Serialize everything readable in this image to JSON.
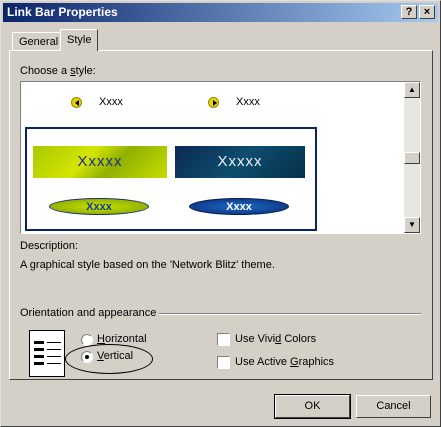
{
  "window": {
    "title": "Link Bar Properties",
    "help_label": "?",
    "close_label": "×"
  },
  "tabs": [
    {
      "label": "General"
    },
    {
      "label": "Style",
      "selected": true
    }
  ],
  "style_list": {
    "label_pre": "Choose a ",
    "label_key": "s",
    "label_post": "tyle:",
    "items": [
      {
        "text": "Xxxx",
        "bullet": "left-arrow-bullet"
      },
      {
        "text": "Xxxx",
        "bullet": "right-arrow-bullet"
      },
      {
        "text": "Xxxxx",
        "theme": "green"
      },
      {
        "text": "Xxxxx",
        "theme": "blue"
      },
      {
        "text": "Xxxx",
        "theme": "green"
      },
      {
        "text": "Xxxx",
        "theme": "blue"
      }
    ],
    "colors": {
      "selection_border": "#0a246a",
      "bullet": "#e6d400"
    }
  },
  "description": {
    "label": "Description:",
    "text": "A graphical style based on the 'Network Blitz' theme."
  },
  "orientation": {
    "label": "Orientation and appearance",
    "horizontal": {
      "pre": "",
      "key": "H",
      "post": "orizontal",
      "selected": false
    },
    "vertical": {
      "pre": "",
      "key": "V",
      "post": "ertical",
      "selected": true
    },
    "vivid": {
      "pre": "Use Vivi",
      "key": "d",
      "post": " Colors",
      "checked": false
    },
    "active": {
      "pre": "Use Active ",
      "key": "G",
      "post": "raphics",
      "checked": false
    }
  },
  "buttons": {
    "ok": "OK",
    "cancel": "Cancel"
  },
  "colors": {
    "title_bar_start": "#0a246a",
    "title_bar_end": "#a6caf0",
    "face": "#d4d0c8"
  }
}
